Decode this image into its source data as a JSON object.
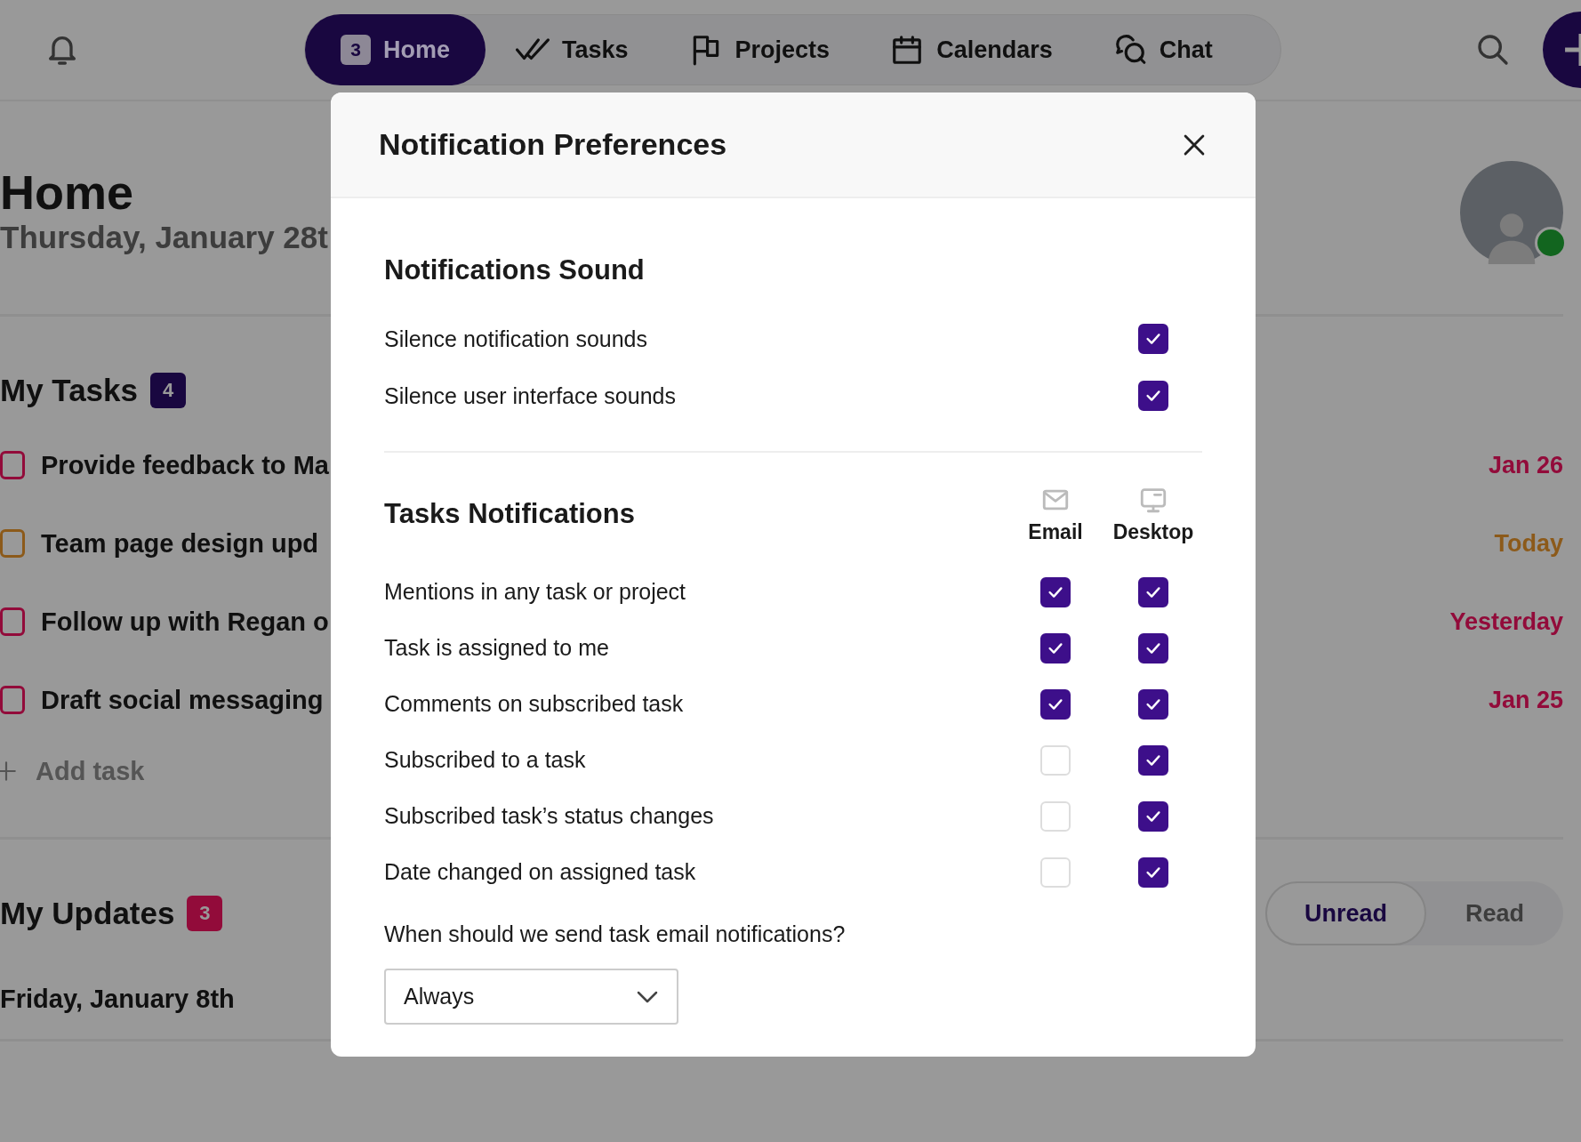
{
  "nav": {
    "tabs": [
      {
        "label": "Home",
        "badge": "3",
        "selected": true
      },
      {
        "label": "Tasks",
        "selected": false
      },
      {
        "label": "Projects",
        "selected": false
      },
      {
        "label": "Calendars",
        "selected": false
      },
      {
        "label": "Chat",
        "selected": false
      }
    ]
  },
  "page": {
    "title": "Home",
    "date": "Thursday, January 28t",
    "my_tasks": {
      "title": "My Tasks",
      "count": "4",
      "tasks": [
        {
          "label": "Provide feedback to Ma",
          "due": "Jan 26",
          "color": "#920b3a"
        },
        {
          "label": "Team page design upd",
          "due": "Today",
          "color": "#8c5a1a"
        },
        {
          "label": "Follow up with Regan o",
          "due": "Yesterday",
          "color": "#920b3a"
        },
        {
          "label": "Draft social messaging",
          "due": "Jan 25",
          "color": "#920b3a"
        }
      ],
      "add_task": "Add task"
    },
    "my_updates": {
      "title": "My Updates",
      "count": "3",
      "filters": [
        {
          "label": "Unread",
          "selected": true
        },
        {
          "label": "Read",
          "selected": false
        }
      ],
      "day": "Friday, January 8th"
    }
  },
  "dialog": {
    "title": "Notification Preferences",
    "sound": {
      "title": "Notifications Sound",
      "rows": [
        {
          "label": "Silence notification sounds",
          "checked": true
        },
        {
          "label": "Silence user interface sounds",
          "checked": true
        }
      ]
    },
    "tasks": {
      "title": "Tasks Notifications",
      "columns": [
        {
          "label": "Email"
        },
        {
          "label": "Desktop"
        }
      ],
      "rows": [
        {
          "label": "Mentions in any task or project",
          "email": true,
          "desktop": true
        },
        {
          "label": "Task is assigned to me",
          "email": true,
          "desktop": true
        },
        {
          "label": "Comments on subscribed task",
          "email": true,
          "desktop": true
        },
        {
          "label": "Subscribed to a task",
          "email": false,
          "desktop": true
        },
        {
          "label": "Subscribed task’s status changes",
          "email": false,
          "desktop": true
        },
        {
          "label": "Date changed on assigned task",
          "email": false,
          "desktop": true
        }
      ]
    },
    "question": "When should we send task email notifications?",
    "select": {
      "value": "Always"
    }
  }
}
